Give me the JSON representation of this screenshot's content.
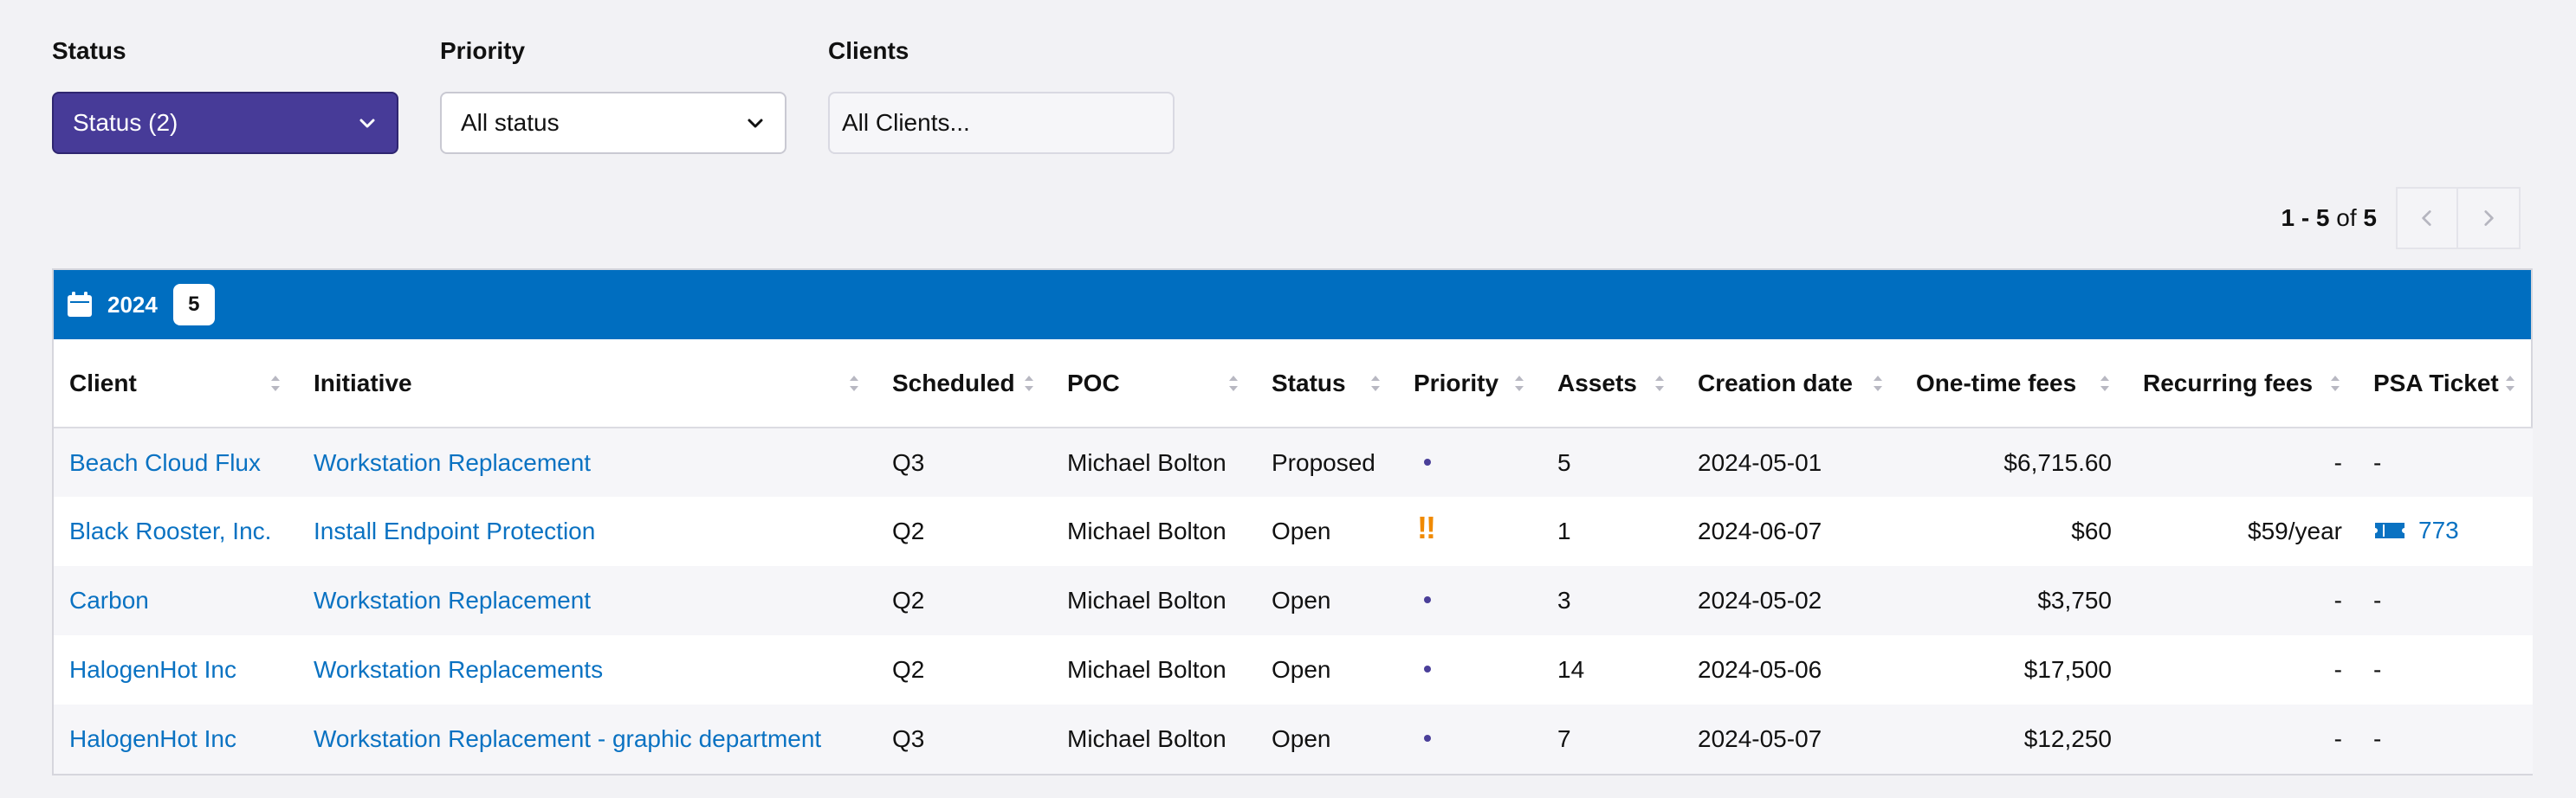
{
  "filters": {
    "status": {
      "label": "Status",
      "value": "Status (2)"
    },
    "priority": {
      "label": "Priority",
      "value": "All status"
    },
    "clients": {
      "label": "Clients",
      "placeholder": "All Clients..."
    }
  },
  "pagination": {
    "range_start": "1",
    "range_end": "5",
    "of_text": "of",
    "total": "5",
    "separator": "-"
  },
  "group": {
    "year": "2024",
    "count": "5"
  },
  "columns": {
    "client": "Client",
    "initiative": "Initiative",
    "scheduled": "Scheduled",
    "poc": "POC",
    "status": "Status",
    "priority": "Priority",
    "assets": "Assets",
    "creation_date": "Creation date",
    "one_time_fees": "One-time fees",
    "recurring_fees": "Recurring fees",
    "psa_ticket": "PSA Ticket"
  },
  "rows": [
    {
      "client": "Beach Cloud Flux",
      "initiative": "Workstation Replacement",
      "scheduled": "Q3",
      "poc": "Michael Bolton",
      "status": "Proposed",
      "priority": "low",
      "assets": "5",
      "creation_date": "2024-05-01",
      "one_time_fees": "$6,715.60",
      "recurring_fees": "-",
      "psa_ticket": "-"
    },
    {
      "client": "Black Rooster, Inc.",
      "initiative": "Install Endpoint Protection",
      "scheduled": "Q2",
      "poc": "Michael Bolton",
      "status": "Open",
      "priority": "high",
      "priority_text": "!!",
      "assets": "1",
      "creation_date": "2024-06-07",
      "one_time_fees": "$60",
      "recurring_fees": "$59/year",
      "psa_ticket": "773"
    },
    {
      "client": "Carbon",
      "initiative": "Workstation Replacement",
      "scheduled": "Q2",
      "poc": "Michael Bolton",
      "status": "Open",
      "priority": "low",
      "assets": "3",
      "creation_date": "2024-05-02",
      "one_time_fees": "$3,750",
      "recurring_fees": "-",
      "psa_ticket": "-"
    },
    {
      "client": "HalogenHot Inc",
      "initiative": "Workstation Replacements",
      "scheduled": "Q2",
      "poc": "Michael Bolton",
      "status": "Open",
      "priority": "low",
      "assets": "14",
      "creation_date": "2024-05-06",
      "one_time_fees": "$17,500",
      "recurring_fees": "-",
      "psa_ticket": "-"
    },
    {
      "client": "HalogenHot Inc",
      "initiative": "Workstation Replacement - graphic department",
      "scheduled": "Q3",
      "poc": "Michael Bolton",
      "status": "Open",
      "priority": "low",
      "assets": "7",
      "creation_date": "2024-05-07",
      "one_time_fees": "$12,250",
      "recurring_fees": "-",
      "psa_ticket": "-"
    }
  ],
  "icons": {
    "status_chevron": "chevron-down-icon",
    "priority_chevron": "chevron-down-icon",
    "prev": "chevron-left-icon",
    "next": "chevron-right-icon",
    "group": "calendar-icon",
    "ticket": "ticket-icon",
    "sort": "sort-icon"
  },
  "colors": {
    "accent_purple": "#473b98",
    "group_bar_blue": "#006ec0",
    "link_blue": "#0a72c2",
    "priority_high": "#f08a00",
    "priority_low": "#4a3f99"
  }
}
